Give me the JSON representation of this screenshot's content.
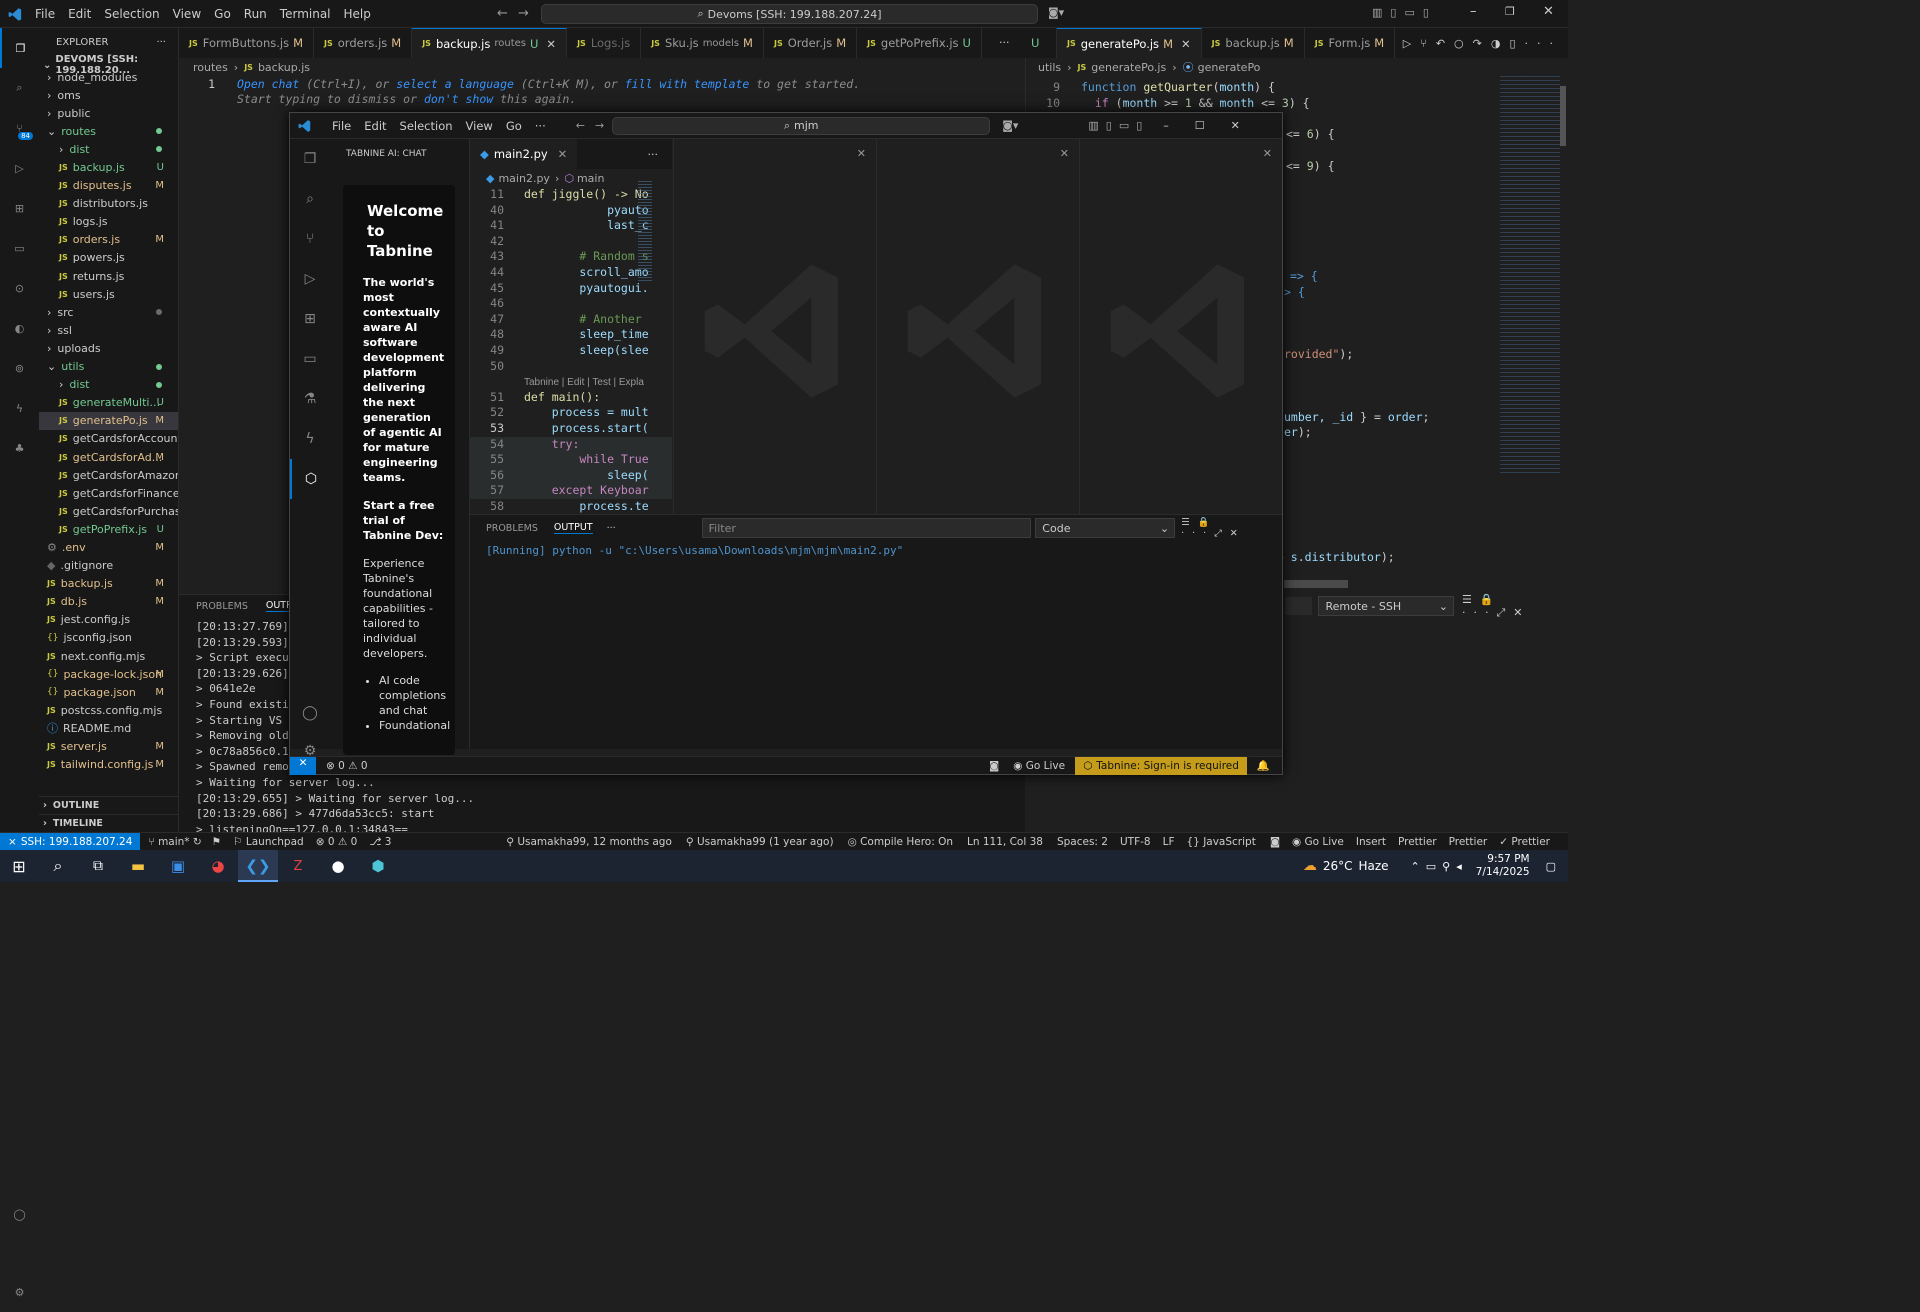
{
  "titlebar": {
    "menu": [
      "File",
      "Edit",
      "Selection",
      "View",
      "Go",
      "Run",
      "Terminal",
      "Help"
    ],
    "search": "Devoms [SSH: 199.188.207.24]"
  },
  "explorer": {
    "title": "EXPLORER",
    "root": "DEVOMS [SSH: 199.188.20...",
    "items": [
      {
        "label": "node_modules",
        "kind": "folder",
        "indent": 1,
        "status": ""
      },
      {
        "label": "oms",
        "kind": "folder",
        "indent": 1,
        "status": ""
      },
      {
        "label": "public",
        "kind": "folder",
        "indent": 1,
        "status": ""
      },
      {
        "label": "routes",
        "kind": "folder-open",
        "indent": 1,
        "status": "dot",
        "color": "#73c991"
      },
      {
        "label": "dist",
        "kind": "folder",
        "indent": 2,
        "status": "dot",
        "color": "#73c991"
      },
      {
        "label": "backup.js",
        "kind": "js",
        "indent": 2,
        "status": "U",
        "color": "#73c991"
      },
      {
        "label": "disputes.js",
        "kind": "js",
        "indent": 2,
        "status": "M",
        "color": "#e2c08d"
      },
      {
        "label": "distributors.js",
        "kind": "js",
        "indent": 2,
        "status": ""
      },
      {
        "label": "logs.js",
        "kind": "js",
        "indent": 2,
        "status": ""
      },
      {
        "label": "orders.js",
        "kind": "js",
        "indent": 2,
        "status": "M",
        "color": "#e2c08d"
      },
      {
        "label": "powers.js",
        "kind": "js",
        "indent": 2,
        "status": ""
      },
      {
        "label": "returns.js",
        "kind": "js",
        "indent": 2,
        "status": ""
      },
      {
        "label": "users.js",
        "kind": "js",
        "indent": 2,
        "status": ""
      },
      {
        "label": "src",
        "kind": "folder",
        "indent": 1,
        "status": "dot"
      },
      {
        "label": "ssl",
        "kind": "folder",
        "indent": 1,
        "status": ""
      },
      {
        "label": "uploads",
        "kind": "folder",
        "indent": 1,
        "status": ""
      },
      {
        "label": "utils",
        "kind": "folder-open",
        "indent": 1,
        "status": "dot",
        "color": "#73c991"
      },
      {
        "label": "dist",
        "kind": "folder",
        "indent": 2,
        "status": "dot",
        "color": "#73c991"
      },
      {
        "label": "generateMulti...",
        "kind": "js",
        "indent": 2,
        "status": "U",
        "color": "#73c991"
      },
      {
        "label": "generatePo.js",
        "kind": "js",
        "indent": 2,
        "status": "M",
        "color": "#e2c08d",
        "selected": true
      },
      {
        "label": "getCardsforAccount.js",
        "kind": "js",
        "indent": 2,
        "status": ""
      },
      {
        "label": "getCardsforAd...",
        "kind": "js",
        "indent": 2,
        "status": "M",
        "color": "#e2c08d"
      },
      {
        "label": "getCardsforAmazon.js",
        "kind": "js",
        "indent": 2,
        "status": ""
      },
      {
        "label": "getCardsforFinance.js",
        "kind": "js",
        "indent": 2,
        "status": ""
      },
      {
        "label": "getCardsforPurchasi...",
        "kind": "js",
        "indent": 2,
        "status": ""
      },
      {
        "label": "getPoPrefix.js",
        "kind": "js",
        "indent": 2,
        "status": "U",
        "color": "#73c991"
      },
      {
        "label": ".env",
        "kind": "gear",
        "indent": 1,
        "status": "M",
        "color": "#e2c08d"
      },
      {
        "label": ".gitignore",
        "kind": "git",
        "indent": 1,
        "status": ""
      },
      {
        "label": "backup.js",
        "kind": "js",
        "indent": 1,
        "status": "M",
        "color": "#e2c08d"
      },
      {
        "label": "db.js",
        "kind": "js",
        "indent": 1,
        "status": "M",
        "color": "#e2c08d"
      },
      {
        "label": "jest.config.js",
        "kind": "js",
        "indent": 1,
        "status": ""
      },
      {
        "label": "jsconfig.json",
        "kind": "json",
        "indent": 1,
        "status": ""
      },
      {
        "label": "next.config.mjs",
        "kind": "js",
        "indent": 1,
        "status": ""
      },
      {
        "label": "package-lock.json",
        "kind": "json",
        "indent": 1,
        "status": "M",
        "color": "#e2c08d"
      },
      {
        "label": "package.json",
        "kind": "json",
        "indent": 1,
        "status": "M",
        "color": "#e2c08d"
      },
      {
        "label": "postcss.config.mjs",
        "kind": "js",
        "indent": 1,
        "status": ""
      },
      {
        "label": "README.md",
        "kind": "info",
        "indent": 1,
        "status": ""
      },
      {
        "label": "server.js",
        "kind": "js",
        "indent": 1,
        "status": "M",
        "color": "#e2c08d"
      },
      {
        "label": "tailwind.config.js",
        "kind": "js",
        "indent": 1,
        "status": "M",
        "color": "#e2c08d"
      }
    ],
    "outline": "OUTLINE",
    "timeline": "TIMELINE"
  },
  "tabs_left": [
    {
      "label": "FormButtons.js",
      "suffix": "M"
    },
    {
      "label": "orders.js",
      "suffix": "M"
    },
    {
      "label": "backup.js",
      "extra": "routes",
      "suffix": "U",
      "active": true
    },
    {
      "label": "Logs.js",
      "suffix": ""
    },
    {
      "label": "Sku.js",
      "extra": "models",
      "suffix": "M"
    },
    {
      "label": "Order.js",
      "suffix": "M"
    },
    {
      "label": "getPoPrefix.js",
      "suffix": "U"
    }
  ],
  "tabs_right": [
    {
      "label": "generatePo.js",
      "suffix": "M",
      "active": true
    },
    {
      "label": "backup.js",
      "suffix": "M"
    },
    {
      "label": "Form.js",
      "suffix": "M"
    }
  ],
  "left_editor": {
    "breadcrumb": [
      "routes",
      "backup.js"
    ],
    "line": "1",
    "hint1_parts": [
      "Open chat",
      " (Ctrl+I), or ",
      "select a language",
      " (Ctrl+K M), or ",
      "fill with template",
      " to get started."
    ],
    "hint2_parts": [
      "Start typing to dismiss or ",
      "don't show",
      " this again."
    ]
  },
  "right_editor": {
    "breadcrumb": [
      "utils",
      "generatePo.js",
      "generatePo"
    ],
    "lines": [
      [
        "9",
        "function getQuarter(month) {"
      ],
      [
        "10",
        "  if (month >= 1 && month <= 3) {"
      ]
    ],
    "frag": [
      "<= 6) {",
      "<= 9) {",
      "=> {",
      "> {",
      "rovided\");",
      "umber, _id } = order;",
      "er);",
      "-> s.distributor);"
    ]
  },
  "bottom_left_panel": {
    "tabs": [
      "PROBLEMS",
      "OUTPU"
    ],
    "lines": [
      "[20:13:27.769]",
      "[20:13:29.593]",
      "> Script execut",
      "[20:13:29.626]",
      "> 0641e2e",
      "> Found existin",
      "> Starting VS C",
      "> Removing old",
      "> 0c78a856c0.1c",
      "> Spawned remot",
      "> Waiting for server log...",
      "[20:13:29.655] > Waiting for server log...",
      "[20:13:29.686] > 477d6da53cc5: start",
      "> listeningOn==127.0.0.1:34843=="
    ]
  },
  "right_panel": {
    "dropdown": "Remote - SSH"
  },
  "win2": {
    "menu": [
      "File",
      "Edit",
      "Selection",
      "View",
      "Go",
      "···"
    ],
    "search": "mjm",
    "sidebar_title": "TABNINE AI: CHAT",
    "tab": "main2.py",
    "breadcrumb": [
      "main2.py",
      "main"
    ],
    "welcome": "Welcome to Tabnine",
    "p1": "The world's most contextually aware AI software development platform delivering the next generation of agentic AI for mature engineering teams.",
    "p2": "Start a free trial of Tabnine Dev:",
    "p3": "Experience Tabnine's foundational capabilities - tailored to individual developers.",
    "bullets": [
      "AI code completions and chat",
      "Foundational"
    ],
    "code": [
      [
        "11",
        "def jiggle() -> No"
      ],
      [
        "40",
        "            pyauto"
      ],
      [
        "41",
        "            last_c"
      ],
      [
        "42",
        ""
      ],
      [
        "43",
        "        # Random s"
      ],
      [
        "44",
        "        scroll_amo"
      ],
      [
        "45",
        "        pyautogui."
      ],
      [
        "46",
        ""
      ],
      [
        "47",
        "        # Another"
      ],
      [
        "48",
        "        sleep_time"
      ],
      [
        "49",
        "        sleep(slee"
      ],
      [
        "50",
        ""
      ],
      [
        "",
        "Tabnine | Edit | Test | Expla"
      ],
      [
        "51",
        "def main():"
      ],
      [
        "52",
        "    process = mult"
      ],
      [
        "53",
        "    process.start("
      ],
      [
        "54",
        "    try:"
      ],
      [
        "55",
        "        while True"
      ],
      [
        "56",
        "            sleep("
      ],
      [
        "57",
        "    except Keyboar"
      ],
      [
        "58",
        "        process.te"
      ]
    ],
    "panel_tabs": [
      "PROBLEMS",
      "OUTPUT",
      "···"
    ],
    "filter": "Filter",
    "dropdown": "Code",
    "output": "[Running] python -u \"c:\\Users\\usama\\Downloads\\mjm\\mjm\\main2.py\"",
    "status": {
      "errors": "0",
      "warnings": "0",
      "golive": "Go Live",
      "tabnine": "Tabnine: Sign-in is required"
    }
  },
  "statusbar": {
    "ssh": "SSH: 199.188.207.24",
    "branch": "main*",
    "launchpad": "Launchpad",
    "errors": "0",
    "warnings": "0",
    "ports": "3",
    "blame1": "Usamakha99, 12 months ago",
    "blame2": "Usamakha99 (1 year ago)",
    "compile": "Compile Hero: On",
    "pos": "Ln 111, Col 38",
    "spaces": "Spaces: 2",
    "enc": "UTF-8",
    "eol": "LF",
    "lang": "JavaScript",
    "golive": "Go Live",
    "insert": "Insert",
    "prettier1": "Prettier",
    "prettier2": "Prettier",
    "prettier3": "Prettier"
  },
  "taskbar": {
    "weather": "26°C",
    "weather_desc": "Haze",
    "time": "9:57 PM",
    "date": "7/14/2025"
  },
  "colors": {
    "accent": "#0078d4",
    "ssh_bg": "#0078d4",
    "tabnine_warn": "#c59d1a",
    "modified": "#e2c08d",
    "untracked": "#73c991"
  }
}
